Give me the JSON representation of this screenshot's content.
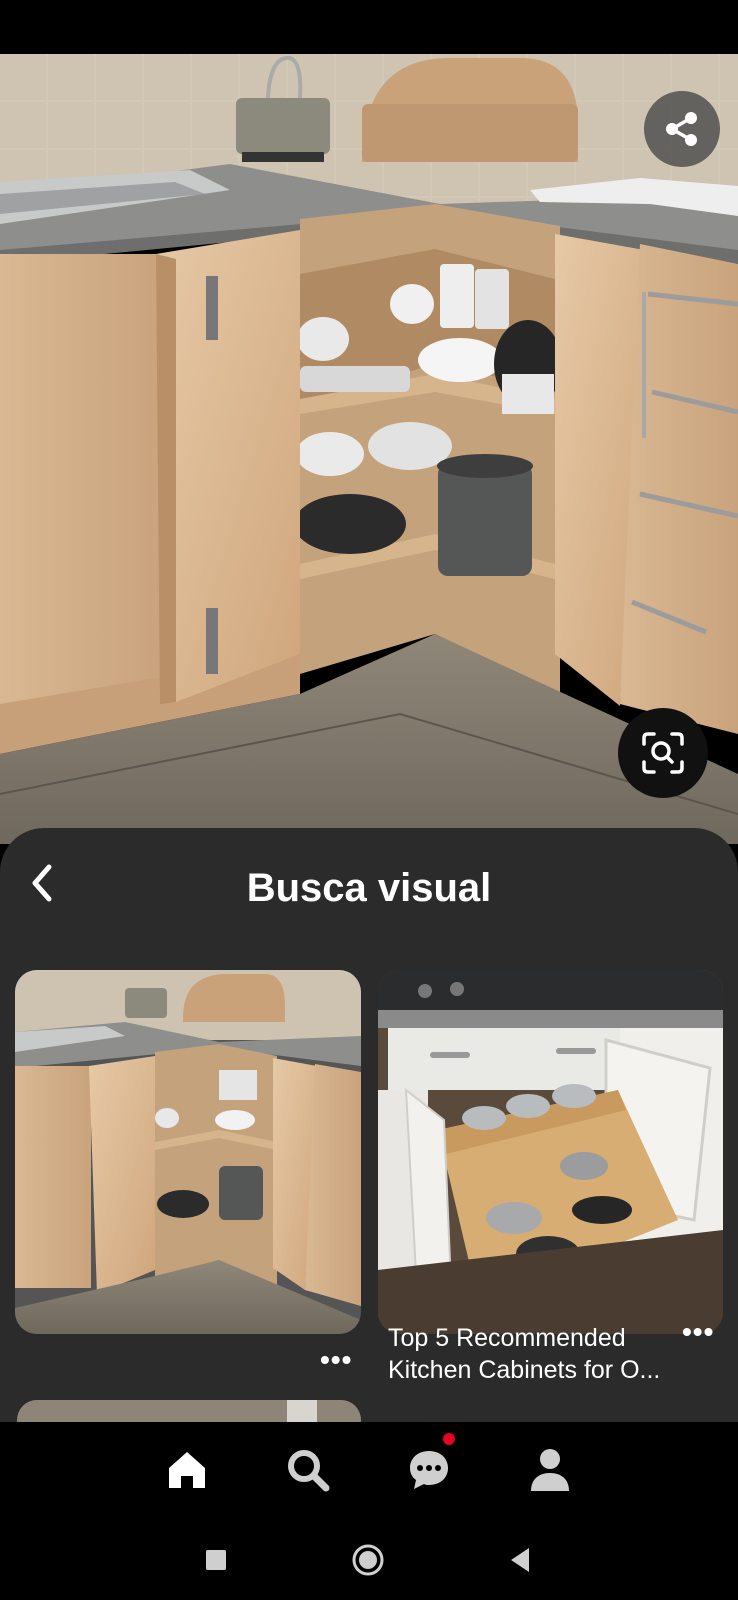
{
  "hero": {
    "image_alt": "kitchen-corner-cabinet-image"
  },
  "buttons": {
    "share_icon": "share-icon",
    "visual_search_icon": "visual-search-icon"
  },
  "sheet": {
    "title": "Busca visual",
    "back_icon": "chevron-left-icon"
  },
  "pins": [
    {
      "image": "corner-cabinet-image",
      "more": "•••",
      "title": ""
    },
    {
      "image": "pull-out-pan-drawer-image",
      "more": "•••",
      "title": "Top 5 Recommended Kitchen Cabinets for O..."
    }
  ],
  "bottom_nav": {
    "items": [
      "home-icon",
      "search-icon",
      "messages-icon",
      "profile-icon"
    ],
    "active": "home-icon",
    "notification_color": "#e60023"
  },
  "system_nav": {
    "items": [
      "recents-icon",
      "home-circle-icon",
      "back-triangle-icon"
    ]
  }
}
